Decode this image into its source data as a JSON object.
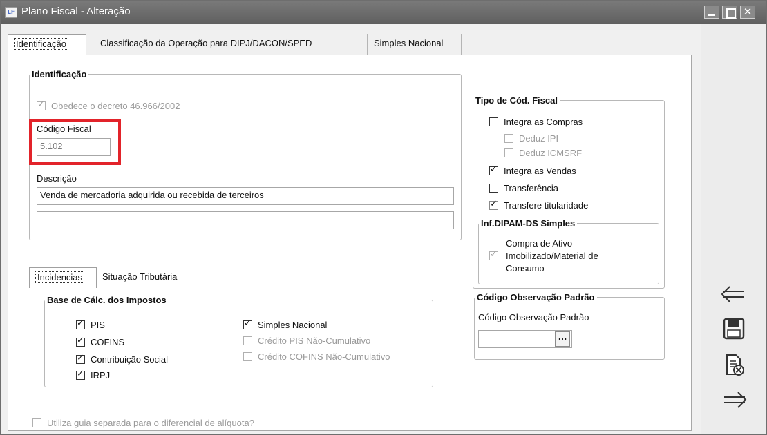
{
  "window": {
    "title": "Plano Fiscal - Alteração",
    "app_icon_text": "LF"
  },
  "tabs": [
    {
      "label": "Identificação",
      "active": true
    },
    {
      "label": "Classificação da Operação para DIPJ/DACON/SPED",
      "active": false
    },
    {
      "label": "Simples Nacional",
      "active": false
    }
  ],
  "identificacao": {
    "legend": "Identificação",
    "obedece_label": "Obedece o decreto 46.966/2002",
    "obedece_checked": true,
    "codigo_fiscal_label": "Código Fiscal",
    "codigo_fiscal_value": "5.102",
    "descricao_label": "Descrição",
    "descricao_value": "Venda de mercadoria adquirida ou recebida de terceiros",
    "descricao2_value": ""
  },
  "subtabs": [
    {
      "label": "Incidencias",
      "active": true
    },
    {
      "label": "Situação Tributária",
      "active": false
    }
  ],
  "base_calc": {
    "legend": "Base de Cálc. dos Impostos",
    "items_left": [
      {
        "label": "PIS",
        "checked": true,
        "disabled": false
      },
      {
        "label": "COFINS",
        "checked": true,
        "disabled": false
      },
      {
        "label": "Contribuição Social",
        "checked": true,
        "disabled": false
      },
      {
        "label": "IRPJ",
        "checked": true,
        "disabled": false
      }
    ],
    "items_right": [
      {
        "label": "Simples Nacional",
        "checked": true,
        "disabled": false
      },
      {
        "label": "Crédito PIS Não-Cumulativo",
        "checked": false,
        "disabled": true
      },
      {
        "label": "Crédito COFINS Não-Cumulativo",
        "checked": false,
        "disabled": true
      }
    ]
  },
  "guia_separada": {
    "label": "Utiliza guia separada para o diferencial de alíquota?",
    "checked": false,
    "disabled": true
  },
  "tipo_cod_fiscal": {
    "legend": "Tipo de Cód. Fiscal",
    "integra_compras": {
      "label": "Integra as Compras",
      "checked": false
    },
    "deduz_ipi": {
      "label": "Deduz IPI",
      "checked": false
    },
    "deduz_icmsrf": {
      "label": "Deduz ICMSRF",
      "checked": false
    },
    "integra_vendas": {
      "label": "Integra as Vendas",
      "checked": true
    },
    "transferencia": {
      "label": "Transferência",
      "checked": false
    },
    "transfere_titularidade": {
      "label": "Transfere titularidade",
      "checked": true
    }
  },
  "dipam": {
    "legend": "Inf.DIPAM-DS Simples",
    "compra_ativo_label": "Compra de Ativo Imobilizado/Material de Consumo",
    "compra_ativo_checked": true
  },
  "observacao": {
    "legend": "Código Observação Padrão",
    "field_label": "Código Observação Padrão",
    "value": "",
    "button_label": "..."
  },
  "side_buttons": [
    {
      "name": "previous-arrow-icon"
    },
    {
      "name": "save-disk-icon"
    },
    {
      "name": "delete-document-icon"
    },
    {
      "name": "next-arrow-icon"
    }
  ],
  "colors": {
    "highlight": "#e2232a",
    "titlebar": "#6b6b6b"
  }
}
